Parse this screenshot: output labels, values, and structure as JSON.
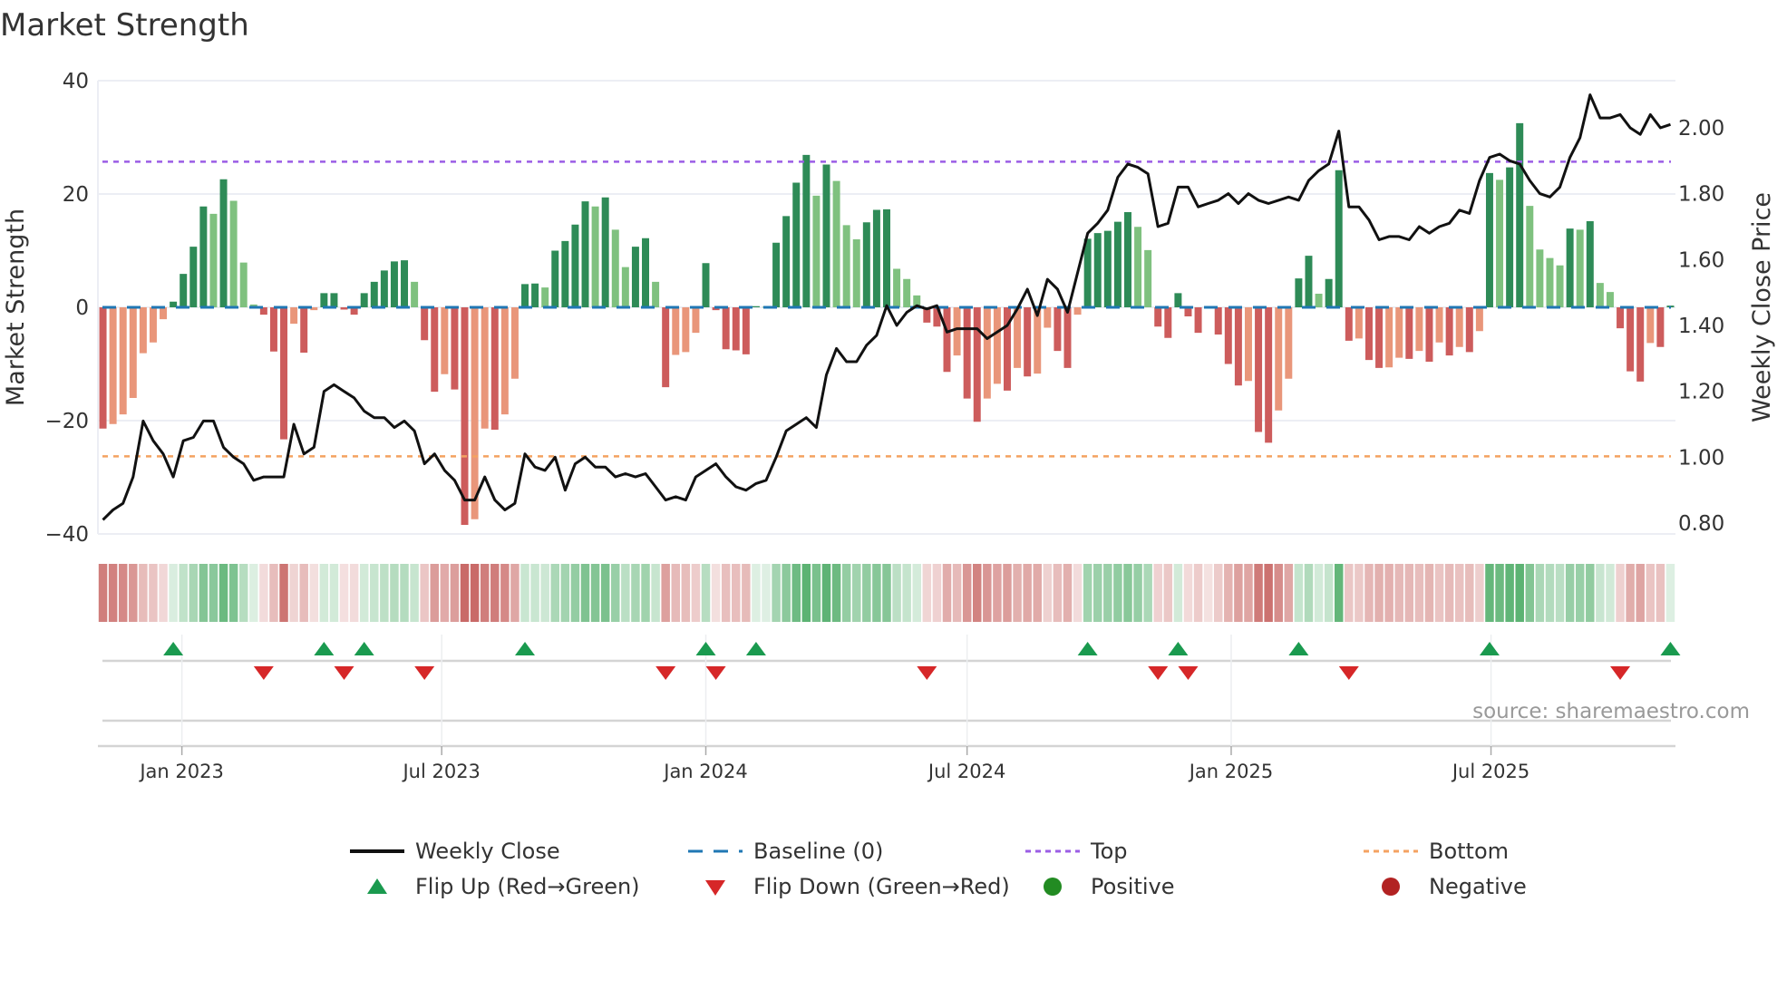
{
  "chart_data": {
    "type": "bar",
    "title": "Market Strength",
    "ylabel": "Market Strength",
    "y2label": "Weekly Close Price",
    "ylim": [
      -40,
      40
    ],
    "y2lim": [
      0.767,
      2.143
    ],
    "yticks": [
      -40,
      -20,
      0,
      20,
      40
    ],
    "yticklabels": [
      "−40",
      "−20",
      "0",
      "20",
      "40"
    ],
    "y2ticks": [
      0.8,
      1.0,
      1.2,
      1.4,
      1.6,
      1.8,
      2.0
    ],
    "y2ticklabels": [
      "0.80",
      "1.00",
      "1.20",
      "1.40",
      "1.60",
      "1.80",
      "2.00"
    ],
    "start_date": "2022-11-07",
    "frequency": "weekly",
    "xticks": [
      {
        "date": "2023-01-01",
        "label": "Jan 2023"
      },
      {
        "date": "2023-07-01",
        "label": "Jul 2023"
      },
      {
        "date": "2024-01-01",
        "label": "Jan 2024"
      },
      {
        "date": "2024-07-01",
        "label": "Jul 2024"
      },
      {
        "date": "2025-01-01",
        "label": "Jan 2025"
      },
      {
        "date": "2025-07-01",
        "label": "Jul 2025"
      }
    ],
    "strength": [
      -21.4,
      -20.6,
      -18.9,
      -16,
      -8.1,
      -6.2,
      -2.1,
      1,
      5.9,
      10.7,
      17.8,
      16.5,
      22.6,
      18.8,
      7.9,
      0.5,
      -1.3,
      -7.8,
      -23.3,
      -2.9,
      -8,
      -0.5,
      2.5,
      2.5,
      -0.4,
      -1.3,
      2.5,
      4.5,
      6.5,
      8.1,
      8.3,
      4.5,
      -5.8,
      -14.9,
      -11.8,
      -14.5,
      -38.4,
      -37.4,
      -21.4,
      -21.6,
      -18.9,
      -12.6,
      4.1,
      4.2,
      3.5,
      10,
      11.7,
      14.6,
      18.7,
      17.8,
      19.4,
      13.7,
      7.1,
      10.7,
      12.2,
      4.5,
      -14.1,
      -8.4,
      -7.9,
      -4.5,
      7.8,
      -0.5,
      -7.4,
      -7.6,
      -8.3,
      0.2,
      0.1,
      11.4,
      16.1,
      22,
      26.9,
      19.7,
      25.2,
      22.3,
      14.5,
      12,
      15,
      17.2,
      17.3,
      6.8,
      5.0,
      2.1,
      -2.7,
      -3.4,
      -11.4,
      -8.5,
      -16.1,
      -20.2,
      -16.1,
      -13.5,
      -14.7,
      -10.7,
      -12.2,
      -11.7,
      -3.6,
      -7.7,
      -10.7,
      -1.3,
      12.1,
      13.1,
      13.5,
      15.1,
      16.8,
      14.2,
      10.1,
      -3.4,
      -5.4,
      2.5,
      -1.6,
      -4.5,
      -0.1,
      -4.8,
      -10,
      -13.8,
      -13,
      -22,
      -23.9,
      -18.2,
      -12.6,
      5.1,
      9.1,
      2.4,
      5.0,
      24.2,
      -5.9,
      -5.5,
      -9.3,
      -10.7,
      -10.6,
      -8.9,
      -9.1,
      -7.7,
      -9.6,
      -6.2,
      -8.5,
      -7,
      -7.9,
      -4.2,
      23.7,
      22.5,
      24.7,
      32.5,
      17.9,
      10.2,
      8.7,
      7.4,
      13.9,
      13.7,
      15.2,
      4.3,
      2.7,
      -3.7,
      -11.3,
      -13.1,
      -6.3,
      -7,
      0.3
    ],
    "weekly_close": [
      0.81,
      0.84,
      0.86,
      0.94,
      1.11,
      1.05,
      1.01,
      0.94,
      1.05,
      1.06,
      1.11,
      1.11,
      1.03,
      1.0,
      0.98,
      0.93,
      0.94,
      0.94,
      0.94,
      1.1,
      1.01,
      1.03,
      1.2,
      1.22,
      1.2,
      1.18,
      1.14,
      1.12,
      1.12,
      1.09,
      1.11,
      1.08,
      0.98,
      1.01,
      0.96,
      0.93,
      0.87,
      0.87,
      0.94,
      0.87,
      0.84,
      0.86,
      1.01,
      0.97,
      0.96,
      1.0,
      0.9,
      0.98,
      1.0,
      0.97,
      0.97,
      0.94,
      0.95,
      0.94,
      0.95,
      0.91,
      0.87,
      0.88,
      0.87,
      0.94,
      0.96,
      0.98,
      0.94,
      0.91,
      0.9,
      0.92,
      0.93,
      1.0,
      1.08,
      1.1,
      1.12,
      1.09,
      1.25,
      1.33,
      1.29,
      1.29,
      1.34,
      1.37,
      1.46,
      1.4,
      1.44,
      1.46,
      1.45,
      1.46,
      1.38,
      1.39,
      1.39,
      1.39,
      1.36,
      1.38,
      1.4,
      1.45,
      1.51,
      1.43,
      1.54,
      1.51,
      1.44,
      1.56,
      1.68,
      1.71,
      1.75,
      1.85,
      1.89,
      1.88,
      1.86,
      1.7,
      1.71,
      1.82,
      1.82,
      1.76,
      1.77,
      1.78,
      1.8,
      1.77,
      1.8,
      1.78,
      1.77,
      1.78,
      1.79,
      1.78,
      1.84,
      1.87,
      1.89,
      1.99,
      1.76,
      1.76,
      1.72,
      1.66,
      1.67,
      1.67,
      1.66,
      1.7,
      1.68,
      1.7,
      1.71,
      1.75,
      1.74,
      1.84,
      1.91,
      1.92,
      1.9,
      1.89,
      1.84,
      1.8,
      1.79,
      1.82,
      1.91,
      1.97,
      2.1,
      2.03,
      2.03,
      2.04,
      2.0,
      1.98,
      2.04,
      2.0,
      2.01
    ],
    "top_level": 25.7,
    "bottom_level": -26.3,
    "baseline": 0,
    "flips_up": [
      7,
      22,
      26,
      42,
      60,
      65,
      98,
      107,
      119,
      138,
      156
    ],
    "flips_down": [
      16,
      24,
      32,
      56,
      61,
      82,
      105,
      108,
      124,
      151
    ],
    "grid": true,
    "legend_position": "bottom",
    "legend": [
      {
        "key": "close",
        "label": "Weekly Close"
      },
      {
        "key": "baseline",
        "label": "Baseline (0)"
      },
      {
        "key": "top",
        "label": "Top"
      },
      {
        "key": "bottom",
        "label": "Bottom"
      },
      {
        "key": "flip_up",
        "label": "Flip Up (Red→Green)"
      },
      {
        "key": "flip_down",
        "label": "Flip Down (Green→Red)"
      },
      {
        "key": "positive",
        "label": "Positive"
      },
      {
        "key": "negative",
        "label": "Negative"
      }
    ],
    "source": "source: sharemaestro.com"
  },
  "colors": {
    "pos_strong": "#2e8b57",
    "pos_weak": "#7fc17f",
    "neg_strong": "#cd5c5c",
    "neg_weak": "#e9967a",
    "close": "#111111",
    "baseline": "#1f77b4",
    "top": "#9b5de5",
    "bottom": "#f4a261",
    "flip_up": "#1a9a4f",
    "flip_down": "#d62728",
    "positive": "#228b22",
    "negative": "#b22222"
  }
}
